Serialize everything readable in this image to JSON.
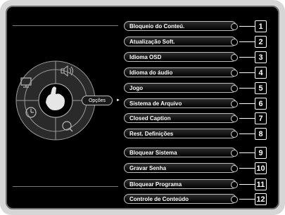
{
  "wheel": {
    "selected_label": "Opções",
    "segments": [
      {
        "name": "picture",
        "icon": "monitor-icon"
      },
      {
        "name": "sound",
        "icon": "speaker-icon"
      },
      {
        "name": "timer",
        "icon": "clock-icon"
      },
      {
        "name": "search",
        "icon": "magnifier-icon"
      }
    ]
  },
  "menu": {
    "items": [
      {
        "label": "Bloqueio do Conteú.",
        "callout": "1"
      },
      {
        "label": "Atualização Soft.",
        "callout": "2"
      },
      {
        "label": "Idioma OSD",
        "callout": "3"
      },
      {
        "label": "Idioma do áudio",
        "callout": "4"
      },
      {
        "label": "Jogo",
        "callout": "5"
      },
      {
        "label": "Sistema de Arquivo",
        "callout": "6"
      },
      {
        "label": "Closed Caption",
        "callout": "7"
      },
      {
        "label": "Rest. Definições",
        "callout": "8"
      },
      {
        "label": "Bloquear Sistema",
        "callout": "9"
      },
      {
        "label": "Gravar Senha",
        "callout": "10"
      },
      {
        "label": "Bloquear Programa",
        "callout": "11"
      },
      {
        "label": "Controle de Conteúdo",
        "callout": "12"
      }
    ]
  }
}
